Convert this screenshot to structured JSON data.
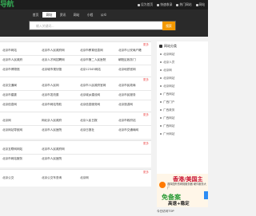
{
  "topbar": {
    "logo": "导航",
    "links": [
      "设为首页",
      "快速收录",
      "热门网站",
      "网站"
    ]
  },
  "nav": {
    "tabs": [
      "首页",
      "网址",
      "资讯",
      "网站",
      "小程",
      "公众"
    ],
    "active_index": 1
  },
  "search": {
    "placeholder": "输入关键词...",
    "button": "搜索"
  },
  "main": {
    "more_label": "更多",
    "blocks": [
      {
        "rows": [
          [
            "北京市网站",
            "北京市人民政府网",
            "北京市教育信息网",
            "北京市公安局户籍"
          ],
          [
            "北京市人民政府",
            "北京人才网招聘网",
            "北京市第二人民医院",
            "朝阳区政务门"
          ],
          [
            "北京市博物馆",
            "北京城市规划馆",
            "北京12345网站",
            "北京地铁官网"
          ]
        ]
      },
      {
        "rows": [
          [
            "北京交通局",
            "北京市人民网",
            "北京市人民政府官网",
            "北京市民政局"
          ],
          [
            "北京市建委",
            "北京市发改委",
            "北京城乡建设网",
            "北京市民服务"
          ],
          [
            "北京信息网",
            "北京市网站导航",
            "北京信息服务网",
            "北京旅游网"
          ]
        ]
      },
      {
        "rows": [
          [
            "北京网",
            "网北京人民政府",
            "北京人民日报",
            "北京市政府站"
          ],
          [
            "北京网站导航网",
            "北京市人民医院",
            "北京日报社",
            "北京市交通局网"
          ]
        ]
      },
      {
        "rows": [
          [
            "北京互联网网站",
            "北京市人民政府网"
          ],
          [
            "北京市网站服务",
            "北京市人民医院"
          ]
        ]
      },
      {
        "rows": [
          [
            "北京公交",
            "北京公交车查询",
            "北京网"
          ]
        ]
      }
    ]
  },
  "sidebar": {
    "title": "网站分类",
    "items": [
      "北京网站",
      "北京人员",
      "北京网",
      "北京网站",
      "北京网站",
      "广西网站",
      "广西门户",
      "广西政务",
      "广西网站",
      "广西网站",
      "广州网站"
    ]
  },
  "ad": {
    "headline": "香港/美国主",
    "body": "选择国外的网络服务器 硬件服务大厂",
    "headline2": "高速+稳定",
    "badge": "免备案",
    "side_tab": "在线客服"
  },
  "bottom_note": "今日访问TOP"
}
